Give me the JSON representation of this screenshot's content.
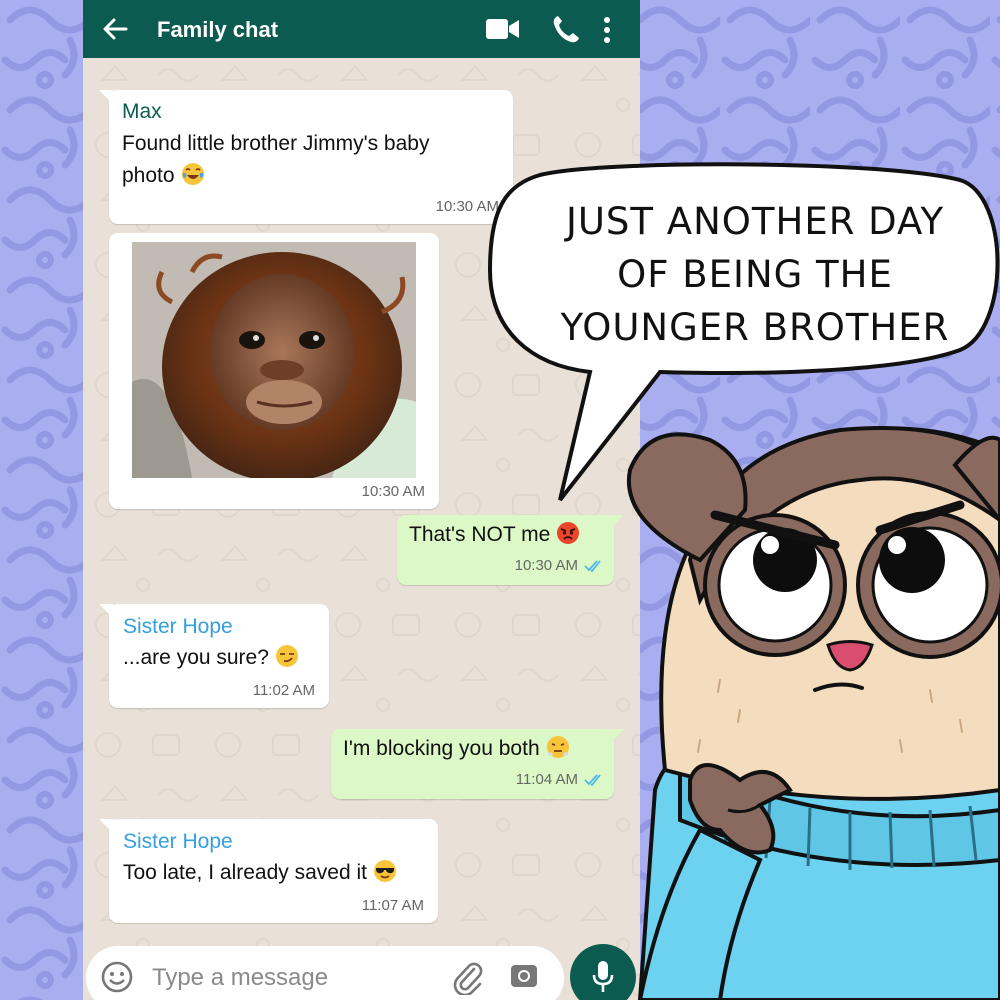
{
  "header": {
    "title": "Family chat"
  },
  "messages": [
    {
      "sender": "Max",
      "line1": "Found little brother Jimmy's baby",
      "line2": "photo",
      "emoji": "laughing-tears-emoji",
      "time": "10:30 AM"
    },
    {
      "image": "baby-orangutan-photo",
      "time": "10:30 AM"
    },
    {
      "text": "That's NOT me",
      "emoji": "angry-face-emoji",
      "time": "10:30 AM"
    },
    {
      "sender": "Sister Hope",
      "text": "...are you sure?",
      "emoji": "smirk-emoji",
      "time": "11:02 AM"
    },
    {
      "text": "I'm blocking you both",
      "emoji": "steam-nose-emoji",
      "time": "11:04 AM"
    },
    {
      "sender": "Sister Hope",
      "text": "Too late, I already saved it",
      "emoji": "sunglasses-emoji",
      "time": "11:07 AM"
    }
  ],
  "composer": {
    "placeholder": "Type a message"
  },
  "comic": {
    "speech_line1": "JUST ANOTHER DAY",
    "speech_line2": "OF BEING THE",
    "speech_line3": "YOUNGER BROTHER"
  },
  "colors": {
    "header": "#0b5b51",
    "incoming_bubble": "#ffffff",
    "outgoing_bubble": "#dcf8c6",
    "sender_max": "#0b5b51",
    "sender_hope": "#34a0e0",
    "read_ticks": "#4fb6ec",
    "background": "#a9aef0",
    "chat_background": "#e9e1d7"
  }
}
